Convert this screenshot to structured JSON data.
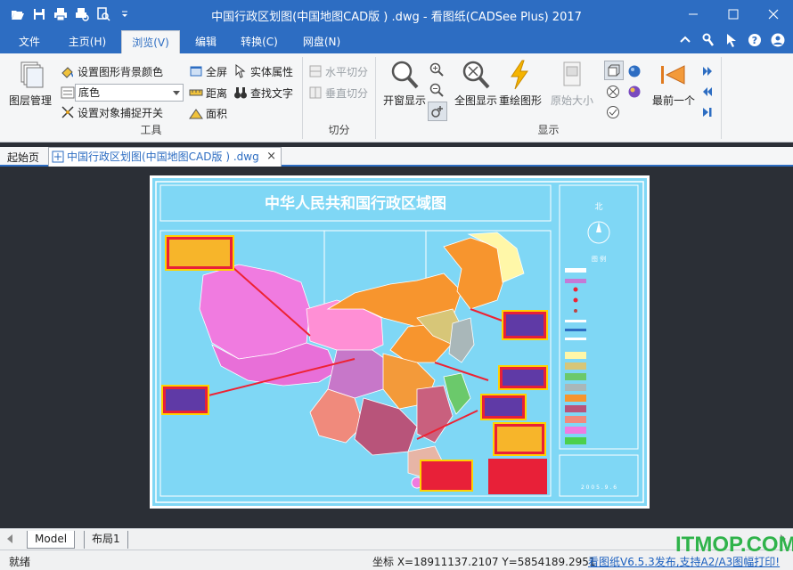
{
  "app": {
    "title": "中国行政区划图(中国地图CAD版 ) .dwg - 看图纸(CADSee Plus) 2017"
  },
  "quick_access": [
    "open-icon",
    "save-icon",
    "print-icon",
    "print-preview-icon",
    "search-doc-icon"
  ],
  "menu_tabs": [
    {
      "label": "文件",
      "active": false
    },
    {
      "label": "主页(H)",
      "active": false
    },
    {
      "label": "浏览(V)",
      "active": true
    },
    {
      "label": "编辑",
      "active": false
    },
    {
      "label": "转换(C)",
      "active": false
    },
    {
      "label": "网盘(N)",
      "active": false
    }
  ],
  "ribbon": {
    "tools": {
      "label": "工具",
      "layer_manager": "图层管理",
      "set_background": "设置图形背景颜色",
      "background_value": "底色",
      "snap_toggle": "设置对象捕捉开关",
      "fullscreen": "全屏",
      "distance": "距离",
      "area": "面积",
      "entity_props": "实体属性",
      "find_text": "查找文字"
    },
    "split": {
      "label": "切分",
      "horizontal": "水平切分",
      "vertical": "垂直切分"
    },
    "display": {
      "label": "显示",
      "window_show": "开窗显示",
      "full_show": "全图显示",
      "redraw": "重绘图形",
      "original_size": "原始大小",
      "prev": "最前一个"
    }
  },
  "doc_tabs": {
    "home": "起始页",
    "file": "中国行政区划图(中国地图CAD版 ) .dwg",
    "close": "×"
  },
  "drawing": {
    "map_title": "中华人民共和国行政区域图",
    "north": "北",
    "legend_title": "图   例",
    "date": "2 0 0 5 . 9 . 6"
  },
  "layout_tabs": [
    "Model",
    "布局1"
  ],
  "status": {
    "ready": "就绪",
    "coords": "坐标 X=18911137.2107 Y=5854189.2951",
    "link": "看图纸V6.5.3发布,支持A2/A3图幅打印!"
  },
  "watermark": "ITMOP.COM",
  "colors": {
    "accent": "#2d6dc2",
    "map_bg": "#7fd7f5",
    "canvas_bg": "#2b2f36"
  }
}
